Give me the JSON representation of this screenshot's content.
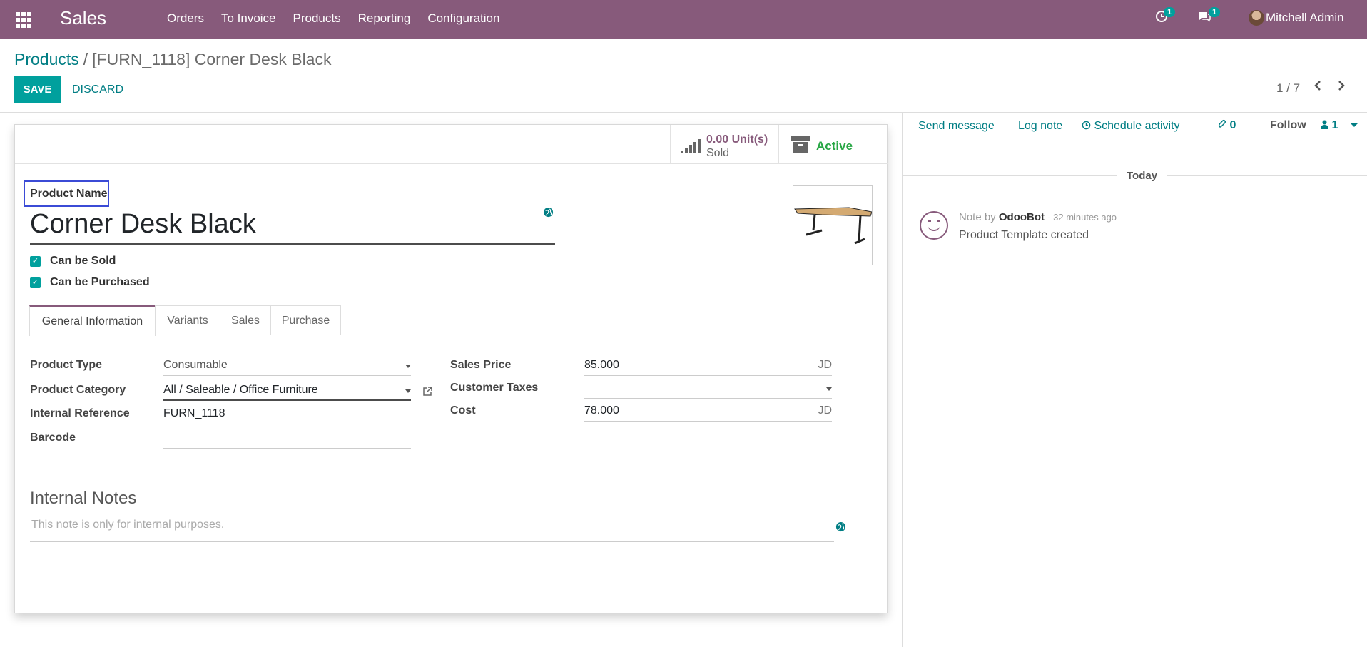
{
  "navbar": {
    "app_name": "Sales",
    "menu": [
      "Orders",
      "To Invoice",
      "Products",
      "Reporting",
      "Configuration"
    ],
    "activity_count": "1",
    "messages_count": "1",
    "user_name": "Mitchell Admin"
  },
  "breadcrumb": {
    "parent": "Products",
    "separator": "/",
    "current": "[FURN_1118] Corner Desk Black"
  },
  "controls": {
    "save_label": "SAVE",
    "discard_label": "DISCARD",
    "pager": "1 / 7"
  },
  "smart_buttons": {
    "sold_value": "0.00 Unit(s)",
    "sold_label": "Sold",
    "active_label": "Active"
  },
  "product": {
    "name_label": "Product Name",
    "name": "Corner Desk Black",
    "can_be_sold_label": "Can be Sold",
    "can_be_sold": true,
    "can_be_purchased_label": "Can be Purchased",
    "can_be_purchased": true,
    "image_icon": "desk-image"
  },
  "tabs": [
    "General Information",
    "Variants",
    "Sales",
    "Purchase"
  ],
  "general": {
    "left": [
      {
        "label": "Product Type",
        "value": "Consumable"
      },
      {
        "label": "Product Category",
        "value": "All / Saleable / Office Furniture"
      },
      {
        "label": "Internal Reference",
        "value": "FURN_1118"
      },
      {
        "label": "Barcode",
        "value": ""
      }
    ],
    "right": [
      {
        "label": "Sales Price",
        "value": "85.000",
        "currency": "JD"
      },
      {
        "label": "Customer Taxes",
        "value": ""
      },
      {
        "label": "Cost",
        "value": "78.000",
        "currency": "JD"
      }
    ]
  },
  "notes": {
    "title": "Internal Notes",
    "placeholder": "This note is only for internal purposes."
  },
  "chatter": {
    "send_message": "Send message",
    "log_note": "Log note",
    "schedule_activity": "Schedule activity",
    "attachments": "0",
    "follow": "Follow",
    "followers": "1",
    "day": "Today",
    "message": {
      "kind": "Note by",
      "author": "OdooBot",
      "date": "- 32 minutes ago",
      "body": "Product Template created"
    }
  },
  "colors": {
    "brand": "#875a7b",
    "accent": "#00a09d",
    "link": "#017e84",
    "active_status": "#28a745"
  }
}
